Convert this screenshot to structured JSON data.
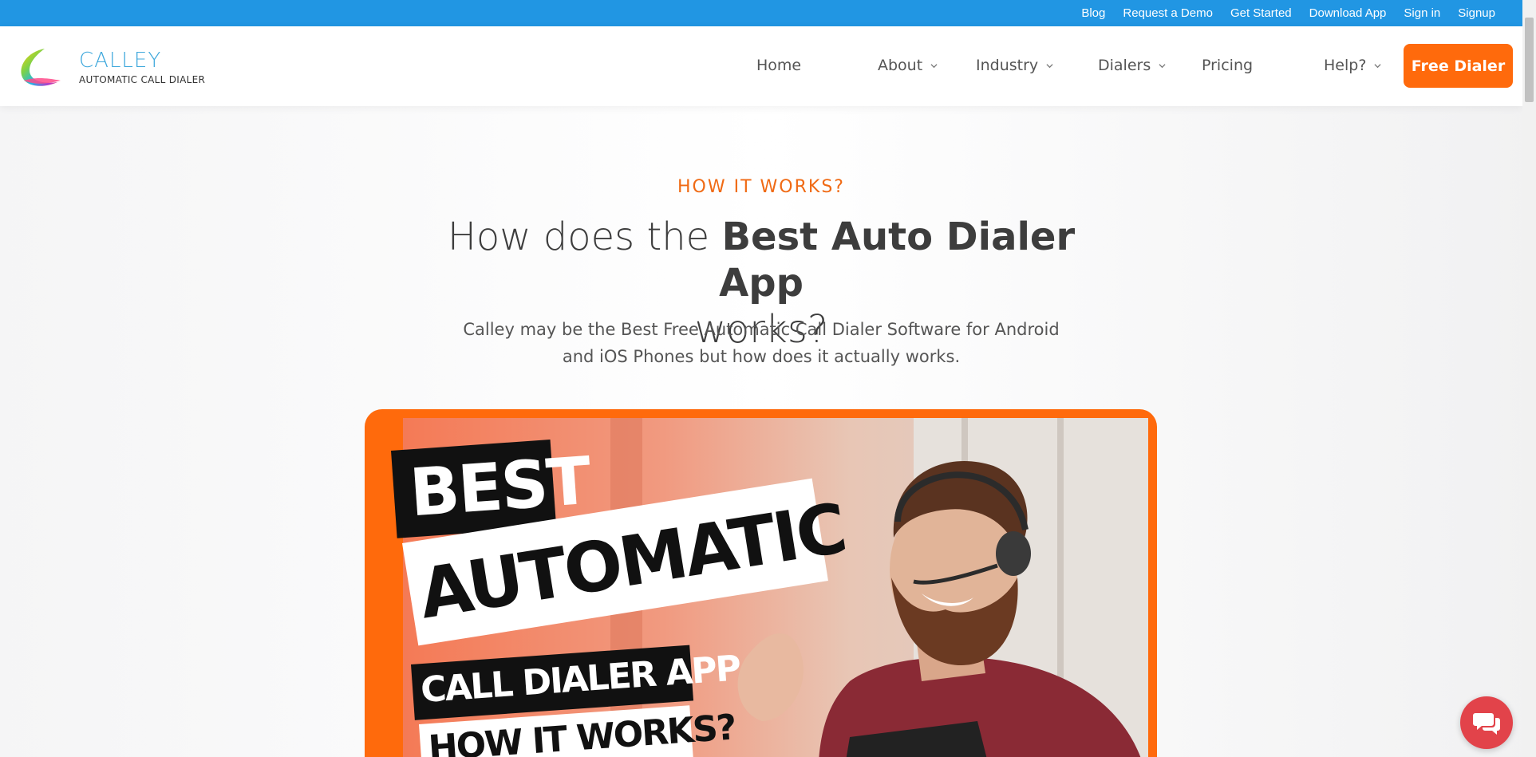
{
  "topbar": {
    "links": [
      "Blog",
      "Request a Demo",
      "Get Started",
      "Download App",
      "Sign in",
      "Signup"
    ]
  },
  "brand": {
    "name": "CALLEY",
    "tagline": "AUTOMATIC CALL DIALER"
  },
  "nav": {
    "home": "Home",
    "about": "About",
    "industry": "Industry",
    "dialers": "Dialers",
    "pricing": "Pricing",
    "help": "Help?",
    "cta": "Free Dialer"
  },
  "hero": {
    "eyebrow": "HOW IT WORKS?",
    "headline_prefix": "How does the ",
    "headline_bold": "Best Auto Dialer App",
    "headline_suffix": "works?",
    "subtext": "Calley may be the Best Free Automatic Call Dialer Software for Android and iOS Phones but how does it actually works."
  },
  "video": {
    "line1": "BEST",
    "line2": "AUTOMATIC",
    "line3": "CALL DIALER APP",
    "line4": "HOW IT WORKS?"
  },
  "colors": {
    "topbar": "#2196e3",
    "accent": "#ff6a0c",
    "eyebrow": "#f06a14",
    "chat": "#e2434a"
  },
  "icons": {
    "dropdown": "chevron-down-icon",
    "chat": "chat-bubble-icon",
    "logo": "calley-swirl-logo"
  }
}
